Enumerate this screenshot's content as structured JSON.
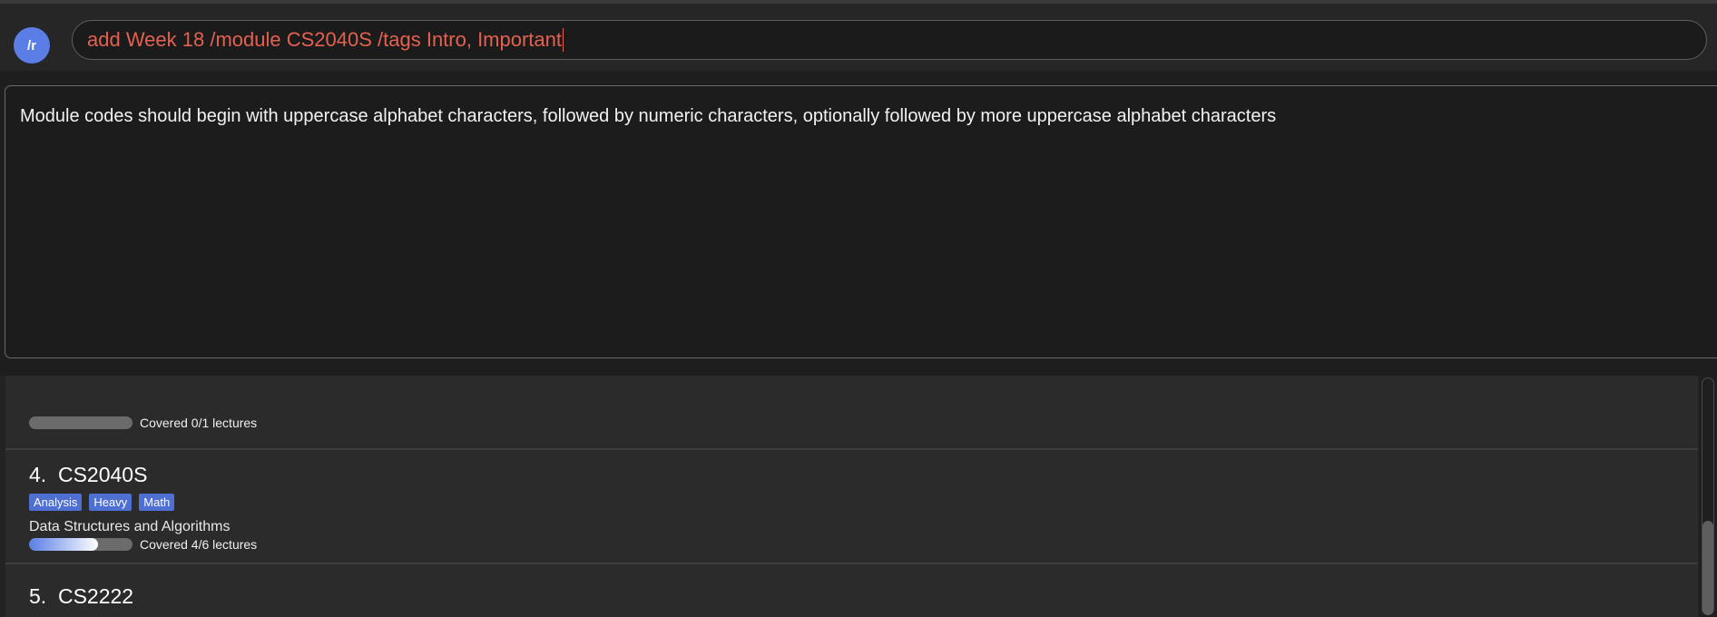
{
  "header": {
    "avatar_label": "/r",
    "command_input_value": "add Week 18 /module CS2040S /tags Intro, Important"
  },
  "result_display": {
    "message": "Module codes should begin with uppercase alphabet characters, followed by numeric characters, optionally followed by more uppercase alphabet characters"
  },
  "modules": [
    {
      "index": "",
      "code": "",
      "tags": [],
      "name": "",
      "progress_label": "Covered 0/1 lectures",
      "progress_fraction": 0.0
    },
    {
      "index": "4.",
      "code": "CS2040S",
      "tags": [
        "Analysis",
        "Heavy",
        "Math"
      ],
      "name": "Data Structures and Algorithms",
      "progress_label": "Covered 4/6 lectures",
      "progress_fraction": 0.6667
    },
    {
      "index": "5.",
      "code": "CS2222",
      "tags": [],
      "name": "",
      "progress_label": "",
      "progress_fraction": 0.0
    }
  ],
  "colors": {
    "accent": "#5b7ee6",
    "error_text": "#e3614f",
    "tag_bg": "#4f6fd3"
  }
}
